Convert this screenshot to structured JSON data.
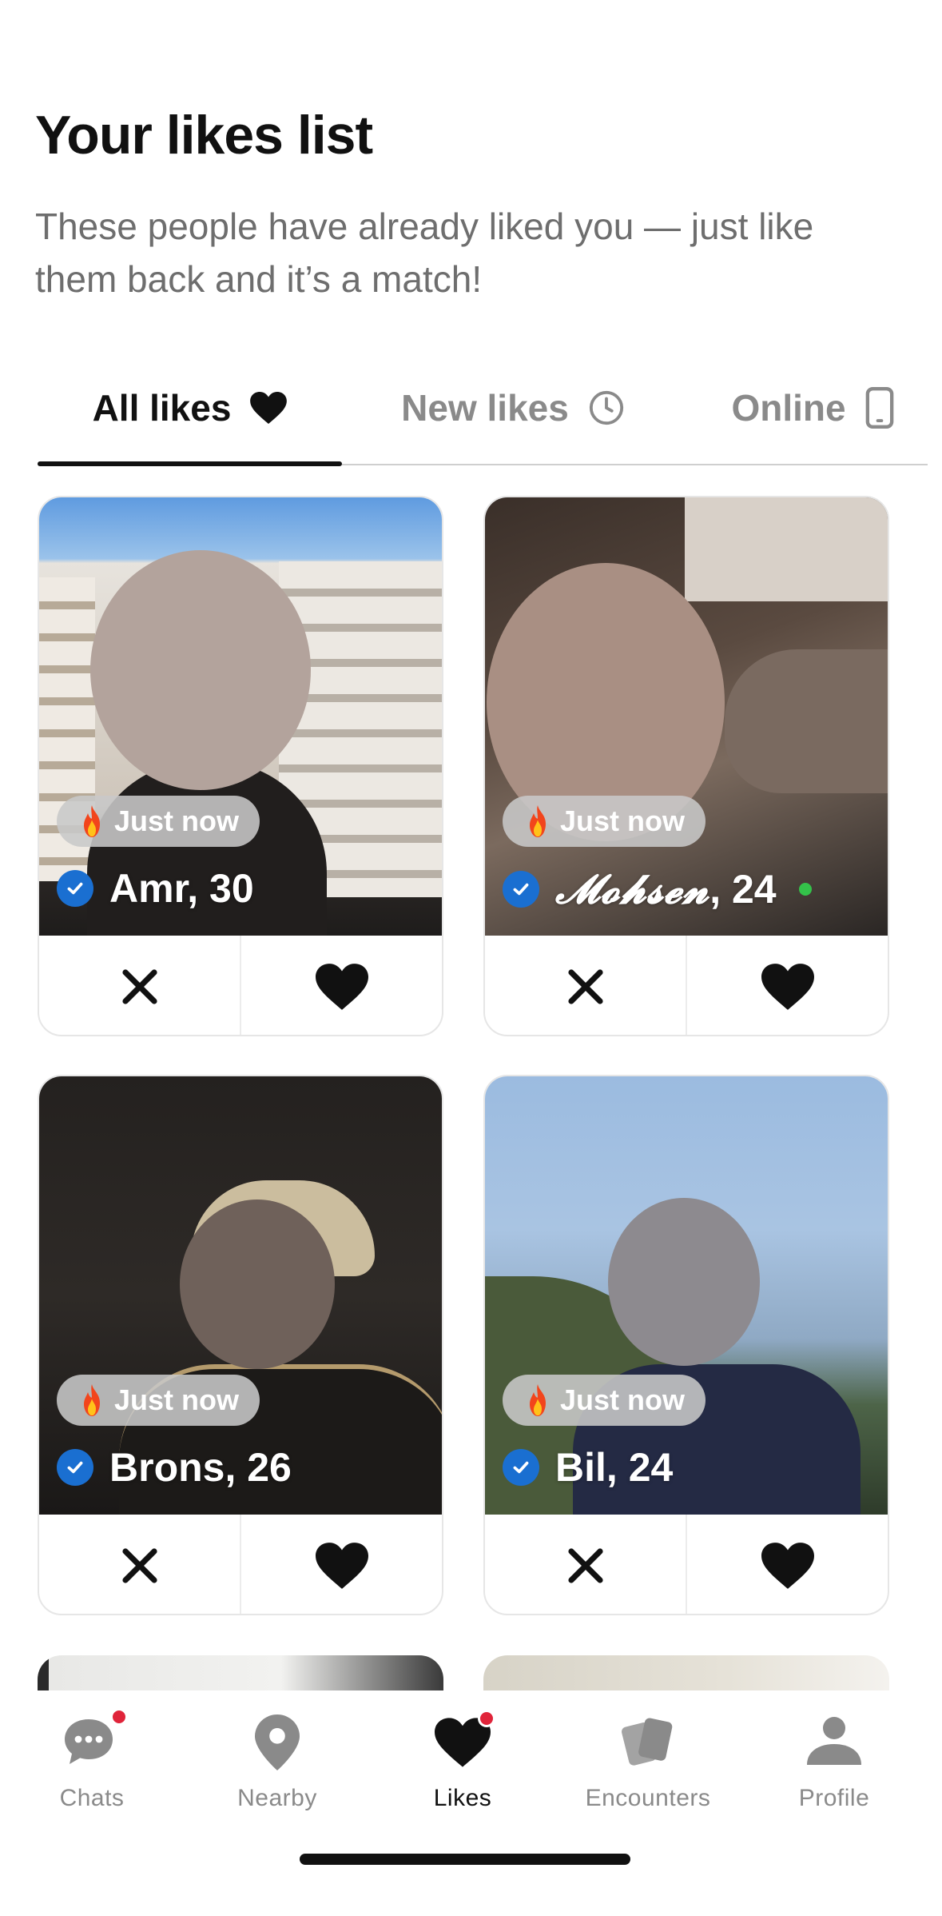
{
  "header": {
    "title": "Your likes list",
    "subtitle": "These people have already liked you — just like them back and it’s a match!"
  },
  "tabs": [
    {
      "label": "All likes",
      "icon": "heart-icon",
      "active": true
    },
    {
      "label": "New likes",
      "icon": "clock-icon",
      "active": false
    },
    {
      "label": "Online",
      "icon": "phone-icon",
      "active": false
    }
  ],
  "cards": [
    {
      "badge": "Just now",
      "name": "Amr",
      "age_text": ", 30",
      "verified": true,
      "online": false
    },
    {
      "badge": "Just now",
      "name": "𝓜𝓸𝓱𝓼𝓮𝓷",
      "age_text": ", 24",
      "verified": true,
      "online": true
    },
    {
      "badge": "Just now",
      "name": "Brons",
      "age_text": ", 26",
      "verified": true,
      "online": false
    },
    {
      "badge": "Just now",
      "name": "Bil",
      "age_text": ", 24",
      "verified": true,
      "online": false
    }
  ],
  "nav": {
    "items": [
      {
        "label": "Chats",
        "icon": "chat-bubbles-icon",
        "notification": true
      },
      {
        "label": "Nearby",
        "icon": "location-pin-icon",
        "notification": false
      },
      {
        "label": "Likes",
        "icon": "heart-icon",
        "notification": true,
        "active": true
      },
      {
        "label": "Encounters",
        "icon": "cards-icon",
        "notification": false
      },
      {
        "label": "Profile",
        "icon": "person-icon",
        "notification": false
      }
    ]
  },
  "colors": {
    "verified": "#1a6fd1",
    "online": "#34c24a",
    "notification": "#e0243a",
    "text_muted": "#8a8a8a"
  }
}
